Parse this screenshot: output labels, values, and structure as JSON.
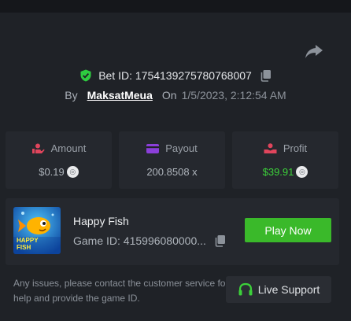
{
  "bet": {
    "id_label": "Bet ID: 1754139275780768007",
    "by_label": "By",
    "username": "MaksatMeua",
    "on_label": "On",
    "date": "1/5/2023, 2:12:54 AM"
  },
  "stats": {
    "amount": {
      "label": "Amount",
      "value": "$0.19",
      "icon": "coins-hand-icon"
    },
    "payout": {
      "label": "Payout",
      "value": "200.8508 x",
      "icon": "card-icon"
    },
    "profit": {
      "label": "Profit",
      "value": "$39.91",
      "icon": "hand-coin-icon"
    }
  },
  "game": {
    "title": "Happy Fish",
    "id_label": "Game ID: 415996080000...",
    "thumb_text_1": "HAPPY",
    "thumb_text_2": "FISH",
    "play_label": "Play Now"
  },
  "support": {
    "issues_text": "Any issues, please contact the customer service for help and provide the game ID.",
    "live_label": "Live Support"
  },
  "colors": {
    "accent_green": "#3ab92a",
    "profit_green": "#3cd13a",
    "shield_green": "#2ecc40",
    "amount_red": "#e0455c",
    "payout_purple": "#8b3fd9"
  }
}
